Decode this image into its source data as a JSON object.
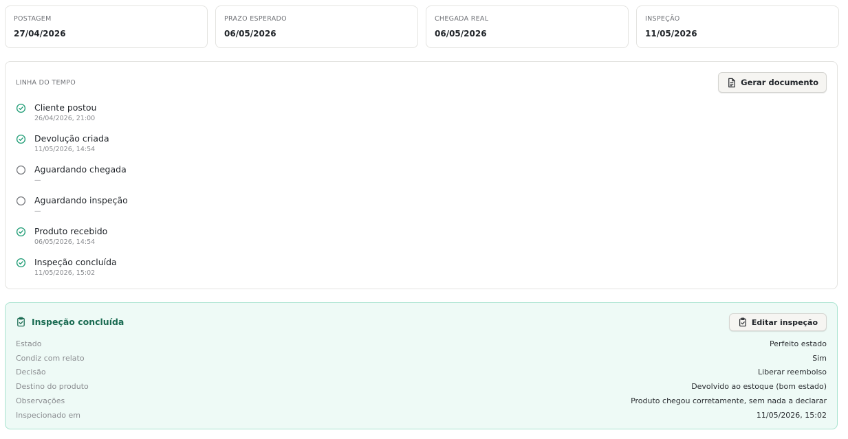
{
  "summary": [
    {
      "label": "POSTAGEM",
      "value": "27/04/2026"
    },
    {
      "label": "PRAZO ESPERADO",
      "value": "06/05/2026"
    },
    {
      "label": "CHEGADA REAL",
      "value": "06/05/2026"
    },
    {
      "label": "INSPEÇÃO",
      "value": "11/05/2026"
    }
  ],
  "timeline": {
    "title": "LINHA DO TEMPO",
    "generate_button": "Gerar documento",
    "events": [
      {
        "label": "Cliente postou",
        "date": "26/04/2026, 21:00",
        "done": true
      },
      {
        "label": "Devolução criada",
        "date": "11/05/2026, 14:54",
        "done": true
      },
      {
        "label": "Aguardando chegada",
        "date": "—",
        "done": false
      },
      {
        "label": "Aguardando inspeção",
        "date": "—",
        "done": false
      },
      {
        "label": "Produto recebido",
        "date": "06/05/2026, 14:54",
        "done": true
      },
      {
        "label": "Inspeção concluída",
        "date": "11/05/2026, 15:02",
        "done": true
      }
    ]
  },
  "inspection": {
    "title": "Inspeção concluída",
    "edit_button": "Editar inspeção",
    "rows": [
      {
        "key": "Estado",
        "value": "Perfeito estado"
      },
      {
        "key": "Condiz com relato",
        "value": "Sim"
      },
      {
        "key": "Decisão",
        "value": "Liberar reembolso"
      },
      {
        "key": "Destino do produto",
        "value": "Devolvido ao estoque (bom estado)"
      },
      {
        "key": "Observações",
        "value": "Produto chegou corretamente, sem nada a declarar"
      },
      {
        "key": "Inspecionado em",
        "value": "11/05/2026, 15:02"
      }
    ]
  },
  "colors": {
    "accent_green": "#1a9a72",
    "pending_gray": "#6e7075",
    "inspection_bg": "#eefaf6",
    "inspection_border": "#a8e3cf"
  },
  "icons": {
    "done": "check-circle-icon",
    "pending": "empty-circle-icon",
    "generate": "document-icon",
    "inspection": "clipboard-check-icon"
  }
}
